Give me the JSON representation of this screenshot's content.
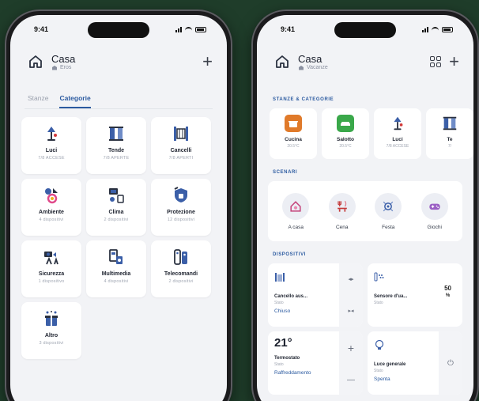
{
  "status": {
    "time": "9:41"
  },
  "left": {
    "home": {
      "title": "Casa",
      "subtitle": "Eros"
    },
    "tabs": [
      {
        "label": "Stanze"
      },
      {
        "label": "Categorie"
      }
    ],
    "categories": [
      {
        "name": "Luci",
        "meta": "7/8 ACCESE",
        "icon": "lamp-icon"
      },
      {
        "name": "Tende",
        "meta": "7/8 APERTE",
        "icon": "curtains-icon"
      },
      {
        "name": "Cancelli",
        "meta": "7/8 APERTI",
        "icon": "gate-icon"
      },
      {
        "name": "Ambiente",
        "meta": "4 dispositivi",
        "icon": "environment-icon"
      },
      {
        "name": "Clima",
        "meta": "2 dispositivi",
        "icon": "climate-icon"
      },
      {
        "name": "Protezione",
        "meta": "12 dispositivi",
        "icon": "protection-icon"
      },
      {
        "name": "Sicurezza",
        "meta": "1 dispositivo",
        "icon": "security-icon"
      },
      {
        "name": "Multimedia",
        "meta": "4 dispositivi",
        "icon": "multimedia-icon"
      },
      {
        "name": "Telecomandi",
        "meta": "2 dispositivi",
        "icon": "remote-icon"
      },
      {
        "name": "Altro",
        "meta": "3 dispositivi",
        "icon": "other-icon"
      }
    ]
  },
  "right": {
    "home": {
      "title": "Casa",
      "subtitle": "Vacanze"
    },
    "sections": {
      "rooms": "STANZE & CATEGORIE",
      "scenes": "SCENARI",
      "devices": "DISPOSITIVI"
    },
    "rooms": [
      {
        "name": "Cucina",
        "meta": "20.5°C",
        "color": "#e07a2a"
      },
      {
        "name": "Salotto",
        "meta": "20.5°C",
        "color": "#3aa84a"
      },
      {
        "name": "Luci",
        "meta": "7/8 ACCESE",
        "color": "#ffffff"
      },
      {
        "name": "Te",
        "meta": "7/",
        "color": "#ffffff"
      }
    ],
    "scenes": [
      {
        "name": "A casa",
        "icon": "house-scene-icon"
      },
      {
        "name": "Cena",
        "icon": "dinner-scene-icon"
      },
      {
        "name": "Festa",
        "icon": "party-scene-icon"
      },
      {
        "name": "Giochi",
        "icon": "games-scene-icon"
      }
    ],
    "devices": {
      "gate": {
        "name": "Cancello aus...",
        "sub": "Stato",
        "state": "Chiuso"
      },
      "sensor": {
        "name": "Sensore d'ua...",
        "sub": "Stato",
        "value": "50",
        "unit": "%"
      },
      "thermo": {
        "temp": "21°",
        "name": "Termostato",
        "sub": "Stato",
        "state": "Raffreddamento"
      },
      "light": {
        "name": "Luce generale",
        "sub": "Stato",
        "state": "Spenta"
      }
    },
    "side_glyphs": {
      "open": "◂▸",
      "close": "▸◂",
      "plus": "+",
      "minus": "—",
      "power": "⏻"
    }
  },
  "colors": {
    "accent": "#2b5aa0",
    "background": "#1f3d2a"
  }
}
